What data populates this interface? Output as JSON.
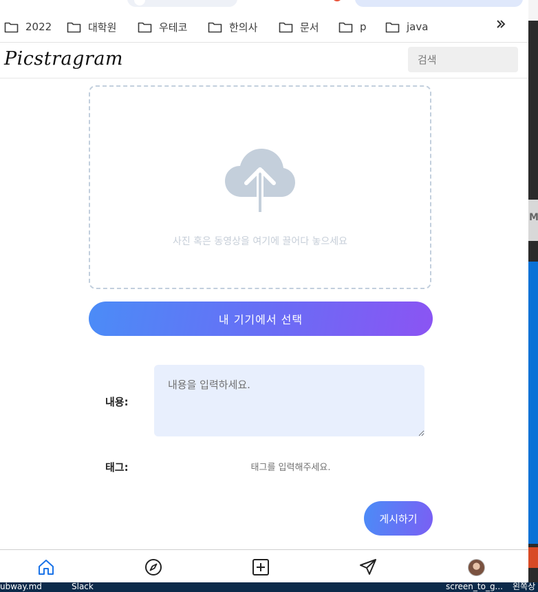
{
  "bookmarks": [
    "2022",
    "대학원",
    "우테코",
    "한의사",
    "문서",
    "p",
    "java"
  ],
  "more_icon": "chevron-double-right-icon",
  "app": {
    "logo": "Picstragram",
    "search_placeholder": "검색"
  },
  "upload": {
    "icon": "cloud-upload-icon",
    "dropzone_text": "사진 혹은 동영상을 여기에 끌어다 놓으세요",
    "pick_button": "내 기기에서 선택"
  },
  "form": {
    "content_label": "내용:",
    "content_placeholder": "내용을 입력하세요.",
    "tags_label": "태그:",
    "tags_placeholder": "태그를 입력해주세요.",
    "submit": "게시하기"
  },
  "bottom_nav": [
    "home-icon",
    "explore-compass-icon",
    "new-post-icon",
    "direct-message-icon",
    "profile-avatar"
  ],
  "colors": {
    "accent_start": "#4b8cf7",
    "accent_end": "#8b54f3",
    "active_nav": "#1a73e8",
    "textarea_bg": "#e8effd"
  },
  "taskbar": [
    "ubway.md",
    "Slack",
    "screen_to_g...",
    "왼쪽상"
  ]
}
